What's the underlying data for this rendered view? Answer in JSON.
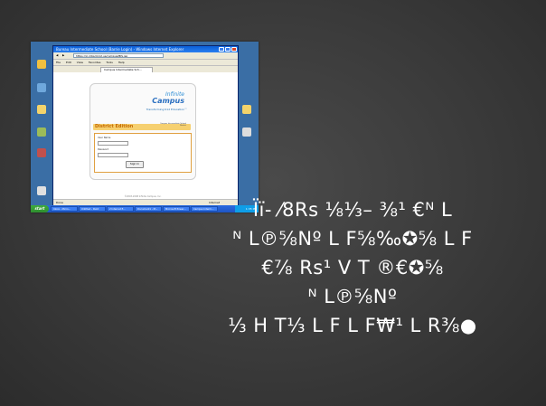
{
  "screenshot": {
    "browser": {
      "title": "Bureau Intermediate School (Barrie Login) - Windows Internet Explorer",
      "address": "https://ic.mbsd.k12.us/campus/BIS.jsp",
      "menu": [
        "File",
        "Edit",
        "View",
        "Favorites",
        "Tools",
        "Help"
      ],
      "tab_label": "Campus Intermediate Sch...",
      "status": "Done",
      "status_right": "Internet"
    },
    "login_card": {
      "logo_top": "Infinite",
      "logo_bottom": "Campus",
      "tagline": "Transforming K12 Education™",
      "district_title": "District Edition",
      "note": "Campus Intermediate School District",
      "user_label": "User Name",
      "password_label": "Password",
      "signin_label": "Sign In",
      "footer": "©2003-2008 Infinite Campus, Inc."
    },
    "taskbar": {
      "start_label": "start",
      "tasks": [
        "Inbox - Micro...",
        "Untitled - Paint",
        "2 Internet E...",
        "Document1 - M...",
        "Microsoft Power...",
        "Campus Interm..."
      ],
      "clock": "1:35 PM"
    }
  },
  "caption_lines": [
    "Ïï- ⁄8Rs  ⅛⅓–  ⅜¹  €ᴺ L",
    "ᴺ L℗⅝Nº L F⅝‰✪⅝ L F",
    "€⅞  Rs¹ V T  ®€✪⅝",
    "ᴺ L℗⅝Nº",
    "⅓  H T⅓ L F L F₩¹ L R⅜●"
  ],
  "colors": {
    "slide_bg": "#3a3a3a",
    "desktop_blue": "#3a6ea5",
    "district_orange": "#c56a00",
    "caption_text": "#ffffff"
  }
}
